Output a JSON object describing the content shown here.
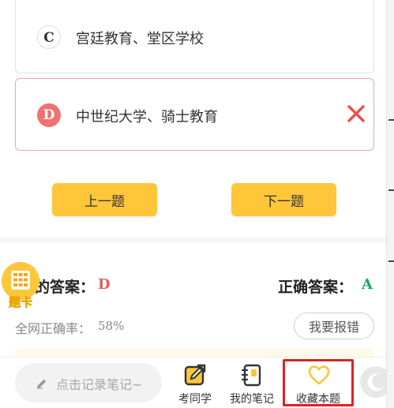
{
  "options": [
    {
      "letter": "C",
      "text": "宫廷教育、堂区学校",
      "state": "normal"
    },
    {
      "letter": "D",
      "text": "中世纪大学、骑士教育",
      "state": "wrong",
      "mark_icon": "close-icon"
    }
  ],
  "nav": {
    "prev_label": "上一题",
    "next_label": "下一题"
  },
  "answer_card": {
    "label": "题卡",
    "icon": "grid-icon"
  },
  "result": {
    "my_answer_label": "的答案：",
    "my_answer_value": "D",
    "correct_label": "正确答案：",
    "correct_value": "A",
    "rate_label": "全网正确率：",
    "rate_value": "58%",
    "report_label": "我要报错"
  },
  "bottom_bar": {
    "note_placeholder": "点击记录笔记~",
    "tools": [
      {
        "label": "考同学",
        "icon": "edit-share-icon"
      },
      {
        "label": "我的笔记",
        "icon": "notebook-icon"
      },
      {
        "label": "收藏本题",
        "icon": "heart-icon",
        "highlighted": true
      }
    ],
    "night_mode_icon": "moon-icon"
  },
  "colors": {
    "accent_yellow": "#ffc63a",
    "wrong_red": "#f07171",
    "correct_green": "#1aa85b",
    "highlight_box": "#e02020"
  }
}
